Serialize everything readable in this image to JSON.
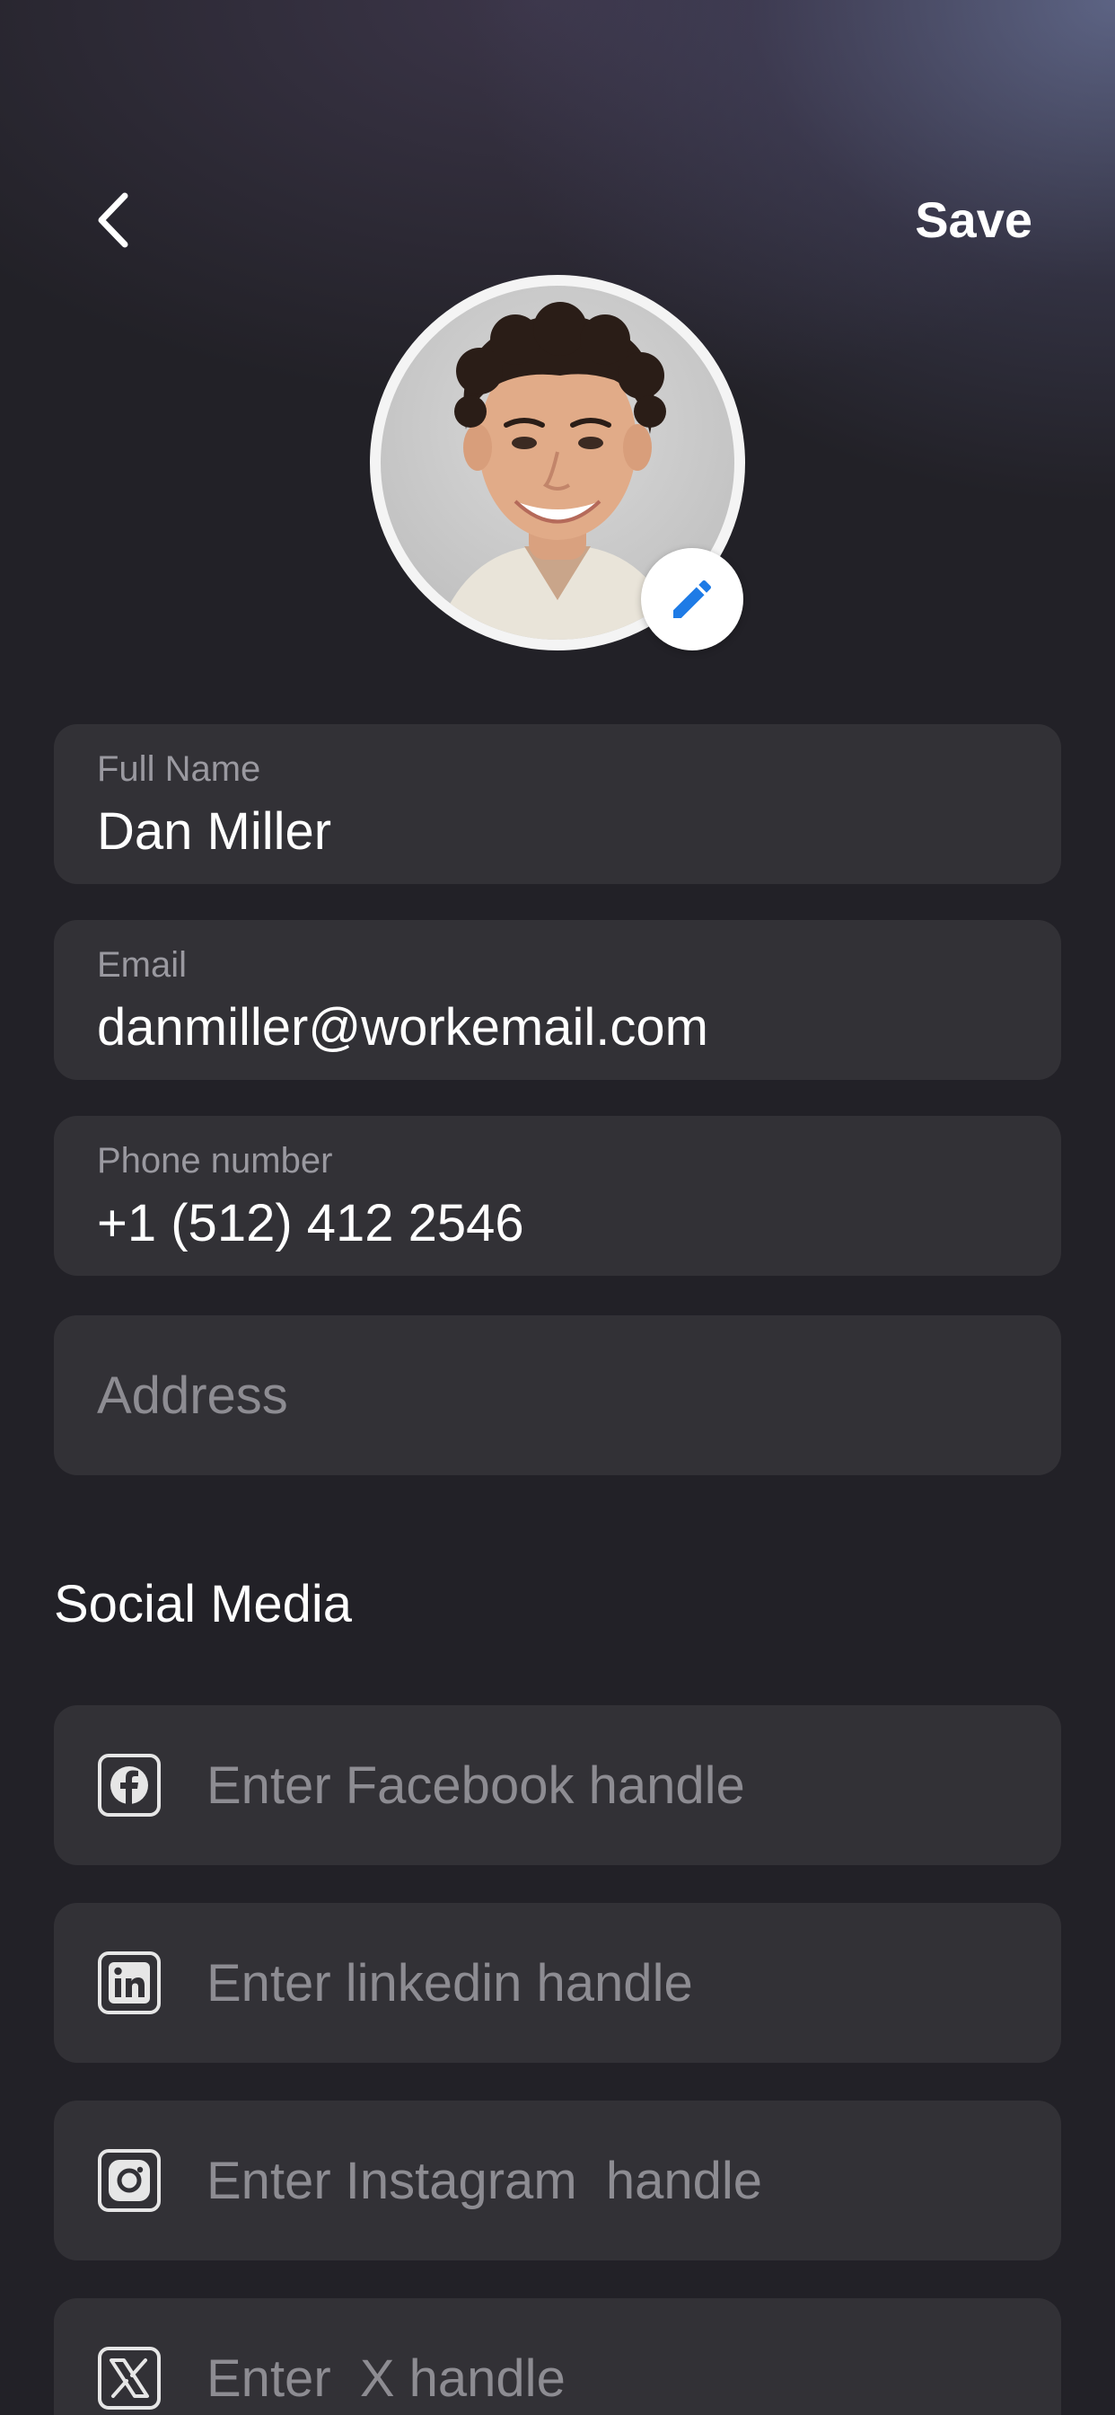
{
  "header": {
    "save_label": "Save"
  },
  "profile": {
    "avatar_icon": "profile-photo",
    "edit_icon": "pencil-icon",
    "edit_icon_color": "#1E7BE6"
  },
  "form": {
    "full_name": {
      "label": "Full Name",
      "value": "Dan Miller"
    },
    "email": {
      "label": "Email",
      "value": "danmiller@workemail.com"
    },
    "phone": {
      "label": "Phone number",
      "value": "+1 (512) 412 2546"
    },
    "address": {
      "placeholder": "Address"
    }
  },
  "social": {
    "title": "Social Media",
    "items": [
      {
        "icon": "facebook-icon",
        "placeholder": "Enter Facebook handle"
      },
      {
        "icon": "linkedin-icon",
        "placeholder": "Enter linkedin handle"
      },
      {
        "icon": "instagram-icon",
        "placeholder": "Enter Instagram  handle"
      },
      {
        "icon": "x-icon",
        "placeholder": "Enter  X handle"
      }
    ]
  },
  "colors": {
    "background": "#222127",
    "field_background": "#323136",
    "accent": "#1E7BE6"
  }
}
